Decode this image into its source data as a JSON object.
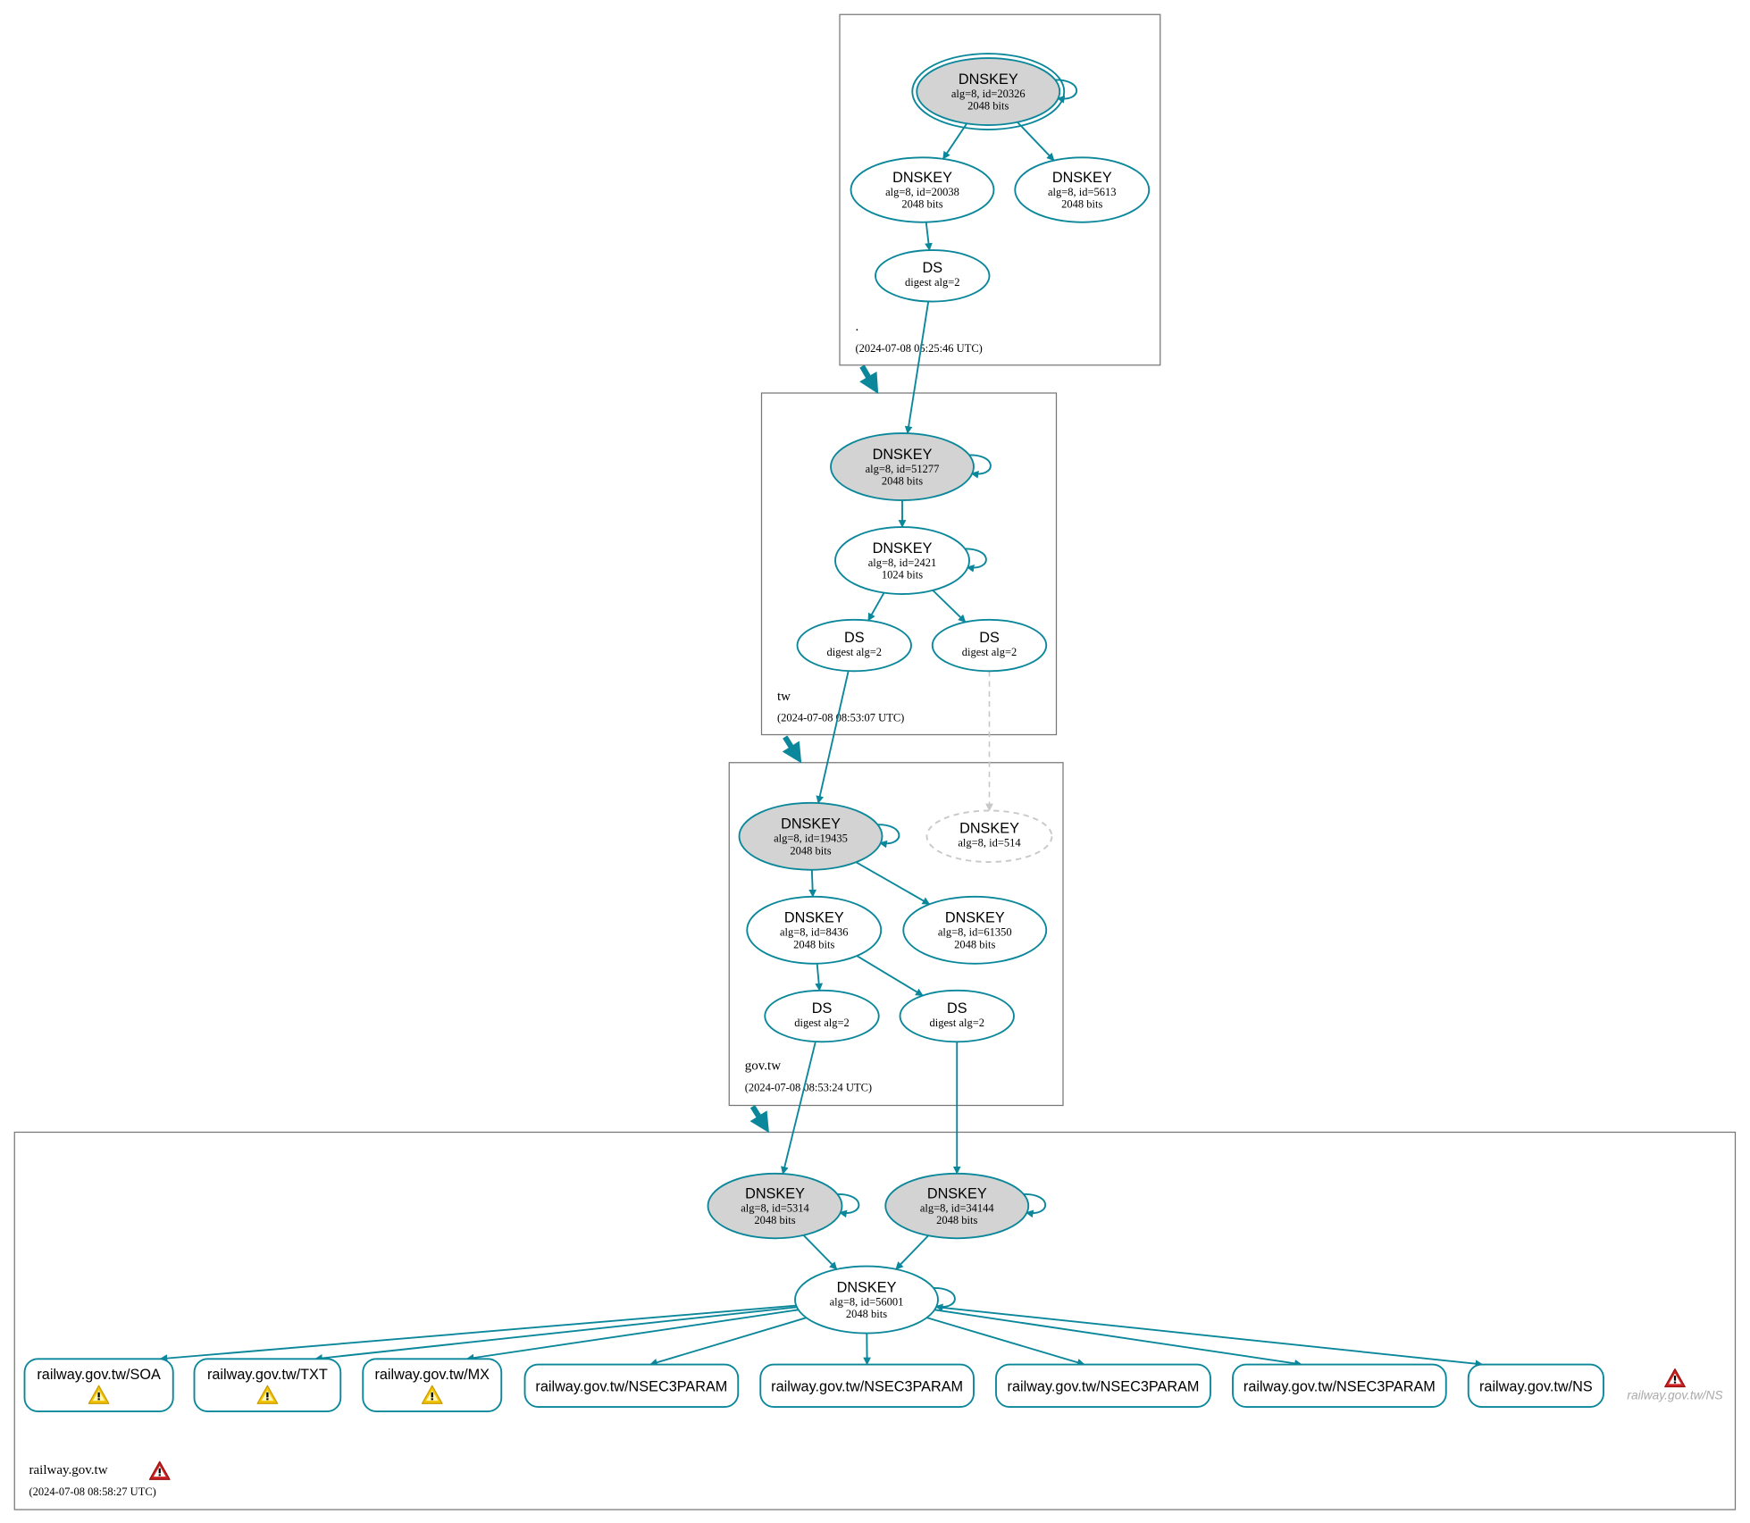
{
  "colors": {
    "edge": "#0a879a",
    "ksk_fill": "#d3d3d3",
    "dangling": "#c8c8c8",
    "warning": "#f2c200",
    "error": "#cc2222"
  },
  "zones": [
    {
      "id": "root",
      "name": ".",
      "time": "(2024-07-08 05:25:46 UTC)"
    },
    {
      "id": "tw",
      "name": "tw",
      "time": "(2024-07-08 08:53:07 UTC)"
    },
    {
      "id": "govtw",
      "name": "gov.tw",
      "time": "(2024-07-08 08:53:24 UTC)"
    },
    {
      "id": "railway",
      "name": "railway.gov.tw",
      "time": "(2024-07-08 08:58:27 UTC)",
      "status_icon": "error-icon"
    }
  ],
  "nodes": [
    {
      "id": "n1",
      "title": "DNSKEY",
      "sub": "alg=8, id=20326",
      "bits": "2048 bits",
      "ksk": true,
      "trust_anchor": true,
      "self_signed": true
    },
    {
      "id": "n2",
      "title": "DNSKEY",
      "sub": "alg=8, id=20038",
      "bits": "2048 bits"
    },
    {
      "id": "n3",
      "title": "DNSKEY",
      "sub": "alg=8, id=5613",
      "bits": "2048 bits"
    },
    {
      "id": "n4",
      "title": "DS",
      "sub": "digest alg=2"
    },
    {
      "id": "t1",
      "title": "DNSKEY",
      "sub": "alg=8, id=51277",
      "bits": "2048 bits",
      "ksk": true,
      "self_signed": true
    },
    {
      "id": "t2",
      "title": "DNSKEY",
      "sub": "alg=8, id=2421",
      "bits": "1024 bits",
      "self_signed": true
    },
    {
      "id": "t3",
      "title": "DS",
      "sub": "digest alg=2"
    },
    {
      "id": "t4",
      "title": "DS",
      "sub": "digest alg=2"
    },
    {
      "id": "g1",
      "title": "DNSKEY",
      "sub": "alg=8, id=19435",
      "bits": "2048 bits",
      "ksk": true,
      "self_signed": true
    },
    {
      "id": "g2",
      "title": "DNSKEY",
      "sub": "alg=8, id=514",
      "dashed": true
    },
    {
      "id": "g3",
      "title": "DNSKEY",
      "sub": "alg=8, id=8436",
      "bits": "2048 bits"
    },
    {
      "id": "g4",
      "title": "DNSKEY",
      "sub": "alg=8, id=61350",
      "bits": "2048 bits"
    },
    {
      "id": "g5",
      "title": "DS",
      "sub": "digest alg=2"
    },
    {
      "id": "g6",
      "title": "DS",
      "sub": "digest alg=2"
    },
    {
      "id": "r1",
      "title": "DNSKEY",
      "sub": "alg=8, id=5314",
      "bits": "2048 bits",
      "ksk": true,
      "self_signed": true
    },
    {
      "id": "r2",
      "title": "DNSKEY",
      "sub": "alg=8, id=34144",
      "bits": "2048 bits",
      "ksk": true,
      "self_signed": true
    },
    {
      "id": "r3",
      "title": "DNSKEY",
      "sub": "alg=8, id=56001",
      "bits": "2048 bits",
      "self_signed": true
    }
  ],
  "records": [
    {
      "id": "rec1",
      "label": "railway.gov.tw/SOA",
      "warning": true
    },
    {
      "id": "rec2",
      "label": "railway.gov.tw/TXT",
      "warning": true
    },
    {
      "id": "rec3",
      "label": "railway.gov.tw/MX",
      "warning": true
    },
    {
      "id": "rec4",
      "label": "railway.gov.tw/NSEC3PARAM"
    },
    {
      "id": "rec5",
      "label": "railway.gov.tw/NSEC3PARAM"
    },
    {
      "id": "rec6",
      "label": "railway.gov.tw/NSEC3PARAM"
    },
    {
      "id": "rec7",
      "label": "railway.gov.tw/NSEC3PARAM"
    },
    {
      "id": "rec8",
      "label": "railway.gov.tw/NS"
    }
  ],
  "error_node": {
    "label": "railway.gov.tw/NS",
    "icon": "error-icon"
  },
  "edges": [
    [
      "n1",
      "n2"
    ],
    [
      "n1",
      "n3"
    ],
    [
      "n2",
      "n4"
    ],
    [
      "n4",
      "t1"
    ],
    [
      "t1",
      "t2"
    ],
    [
      "t2",
      "t3"
    ],
    [
      "t2",
      "t4"
    ],
    [
      "t3",
      "g1"
    ],
    [
      "t4",
      "g2",
      "dashed"
    ],
    [
      "g1",
      "g3"
    ],
    [
      "g1",
      "g4"
    ],
    [
      "g3",
      "g5"
    ],
    [
      "g3",
      "g6"
    ],
    [
      "g5",
      "r1"
    ],
    [
      "g6",
      "r2"
    ],
    [
      "r1",
      "r3"
    ],
    [
      "r2",
      "r3"
    ],
    [
      "r3",
      "rec1"
    ],
    [
      "r3",
      "rec2"
    ],
    [
      "r3",
      "rec3"
    ],
    [
      "r3",
      "rec4"
    ],
    [
      "r3",
      "rec5"
    ],
    [
      "r3",
      "rec6"
    ],
    [
      "r3",
      "rec7"
    ],
    [
      "r3",
      "rec8"
    ]
  ]
}
